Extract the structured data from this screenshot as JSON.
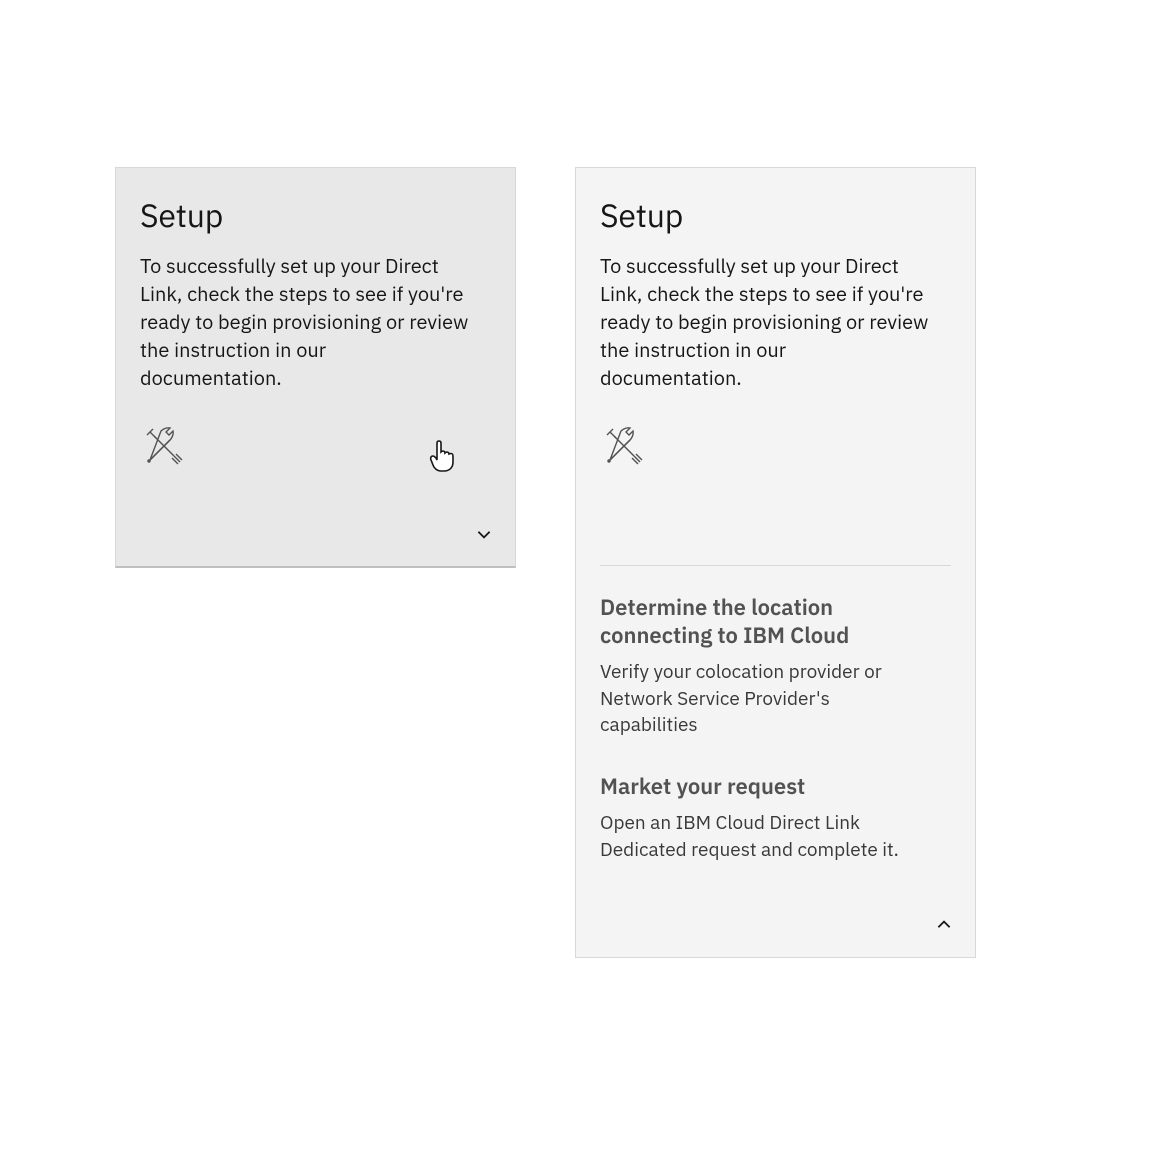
{
  "cardCollapsed": {
    "title": "Setup",
    "description": "To successfully set up your Direct Link, check the steps to see if you're ready to begin provisioning or review the instruction in our documentation."
  },
  "cardExpanded": {
    "title": "Setup",
    "description": "To successfully set up your Direct Link, check the steps to see if you're ready to begin provisioning or review the instruction in our documentation.",
    "steps": [
      {
        "title": "Determine the location connecting to IBM Cloud",
        "desc": "Verify your colocation provider or Network Service Provider's capabilities"
      },
      {
        "title": "Market your request",
        "desc": "Open an IBM Cloud Direct Link Dedicated request and complete it."
      }
    ]
  }
}
